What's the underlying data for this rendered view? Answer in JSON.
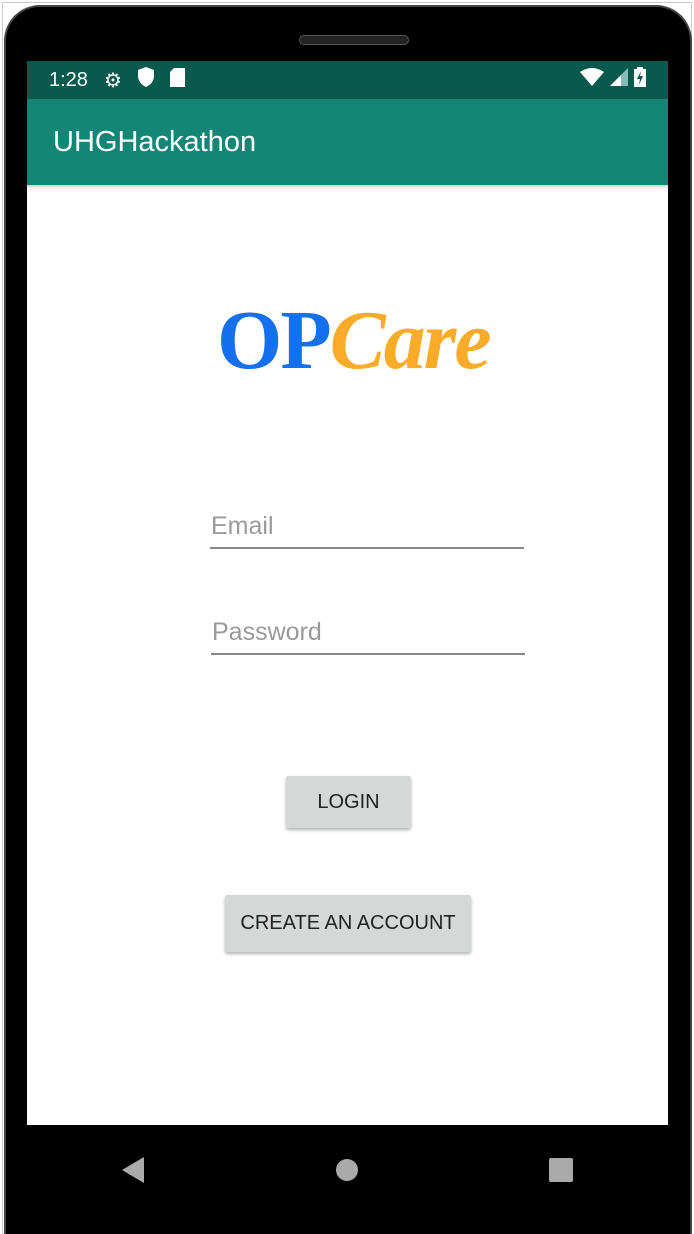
{
  "status": {
    "time": "1:28",
    "icons": [
      "gear-icon",
      "shield-icon",
      "sd-card-icon",
      "wifi-icon",
      "signal-icon",
      "battery-charging-icon"
    ]
  },
  "appbar": {
    "title": "UHGHackathon"
  },
  "logo": {
    "part1": "OP",
    "part2": "Care",
    "colors": {
      "op": "#1570ef",
      "care": "#fbab2a"
    }
  },
  "form": {
    "email_placeholder": "Email",
    "password_placeholder": "Password",
    "login_label": "LOGIN",
    "create_label": "CREATE AN ACCOUNT"
  },
  "colors": {
    "status": "#075a4c",
    "appbar": "#138676"
  }
}
